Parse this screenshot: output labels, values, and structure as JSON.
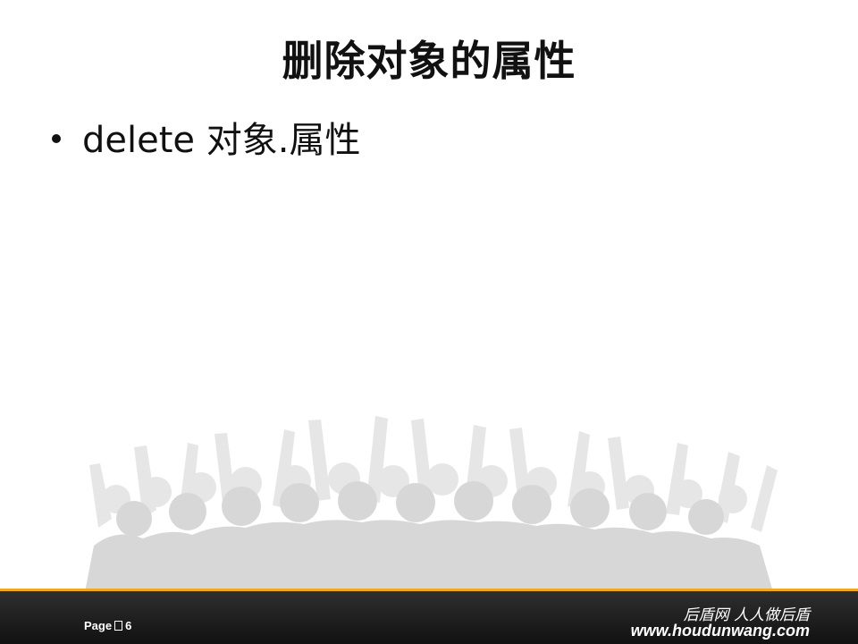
{
  "slide": {
    "title": "删除对象的属性",
    "bullets": [
      {
        "text": "delete 对象.属性"
      }
    ]
  },
  "footer": {
    "page_prefix": "Page",
    "page_number": "6",
    "slogan": "后盾网 人人做后盾",
    "site": "www.houdunwang.com",
    "accent_color": "#f0a81c",
    "bar_color": "#1a1a1a"
  }
}
